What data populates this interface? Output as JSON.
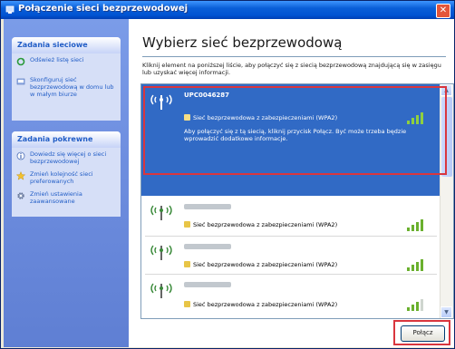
{
  "window": {
    "title": "Połączenie sieci bezprzewodowej"
  },
  "sidebar": {
    "panels": [
      {
        "title": "Zadania sieciowe",
        "items": [
          {
            "label": "Odśwież listę sieci",
            "icon": "refresh-icon"
          },
          {
            "label": "Skonfiguruj sieć bezprzewodową w domu lub w małym biurze",
            "icon": "setup-icon"
          }
        ]
      },
      {
        "title": "Zadania pokrewne",
        "items": [
          {
            "label": "Dowiedz się więcej o sieci bezprzewodowej",
            "icon": "info-icon"
          },
          {
            "label": "Zmień kolejność sieci preferowanych",
            "icon": "star-icon"
          },
          {
            "label": "Zmień ustawienia zaawansowane",
            "icon": "gear-icon"
          }
        ]
      }
    ]
  },
  "main": {
    "heading": "Wybierz sieć bezprzewodową",
    "description": "Kliknij element na poniższej liście, aby połączyć się z siecią bezprzewodową znajdującą się w zasięgu lub uzyskać więcej informacji.",
    "networks": [
      {
        "name": "UPC0046287",
        "security": "Sieć bezprzewodowa z zabezpieczeniami (WPA2)",
        "message": "Aby połączyć się z tą siecią, kliknij przycisk Połącz. Być może trzeba będzie wprowadzić dodatkowe informacje.",
        "selected": true,
        "signal": 4
      },
      {
        "name": "",
        "security": "Sieć bezprzewodowa z zabezpieczeniami (WPA2)",
        "selected": false,
        "signal": 4
      },
      {
        "name": "",
        "security": "Sieć bezprzewodowa z zabezpieczeniami (WPA2)",
        "selected": false,
        "signal": 4
      },
      {
        "name": "",
        "security": "Sieć bezprzewodowa z zabezpieczeniami (WPA2)",
        "selected": false,
        "signal": 3
      }
    ],
    "connect_label": "Połącz"
  },
  "colors": {
    "titlebar": "#0053d2",
    "selected": "#316ac5",
    "highlight": "#d9363e"
  }
}
